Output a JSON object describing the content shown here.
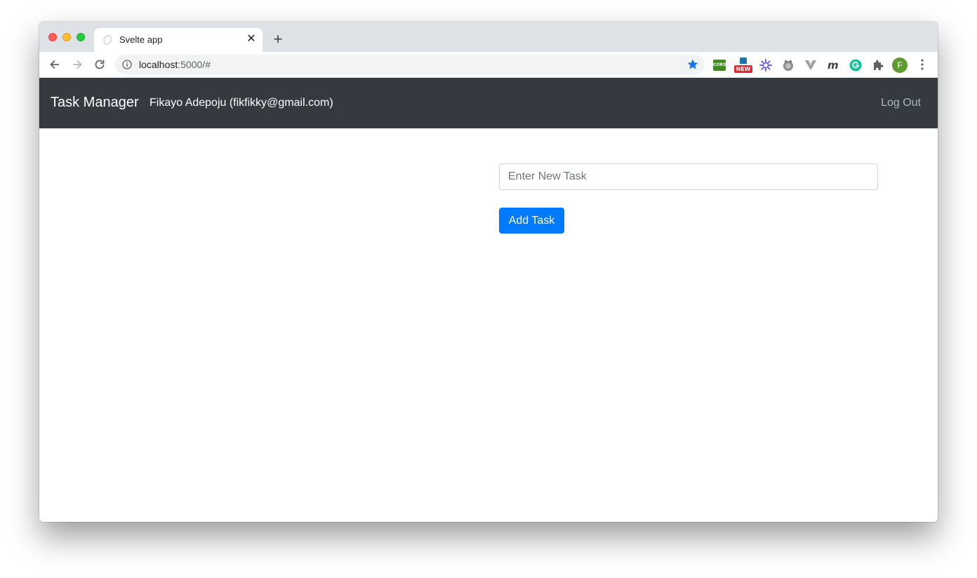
{
  "browser": {
    "tab": {
      "title": "Svelte app",
      "close_icon": "close-icon",
      "favicon": "svelte-icon"
    },
    "new_tab_icon": "plus-icon",
    "address": {
      "host": "localhost",
      "rest": ":5000/#",
      "info_icon": "info-icon",
      "bookmark_icon": "star-icon"
    },
    "extensions": {
      "cors_label": "CORS",
      "new_badge": "NEW",
      "icons": [
        "cors-extension-icon",
        "new-extension-icon",
        "gear-flower-icon",
        "cat-icon",
        "v-icon",
        "m-icon",
        "grammarly-icon",
        "puzzle-icon"
      ]
    },
    "profile_initial": "F",
    "colors": {
      "accent": "#1a73e8",
      "tabstrip": "#dee1e6",
      "omnibox": "#f1f3f4"
    }
  },
  "app": {
    "navbar": {
      "brand": "Task Manager",
      "user": "Fikayo Adepoju (fikfikky@gmail.com)",
      "logout": "Log Out"
    },
    "form": {
      "placeholder": "Enter New Task",
      "value": "",
      "button_label": "Add Task"
    },
    "colors": {
      "navbar_bg": "#343a40",
      "primary": "#007bff"
    }
  }
}
